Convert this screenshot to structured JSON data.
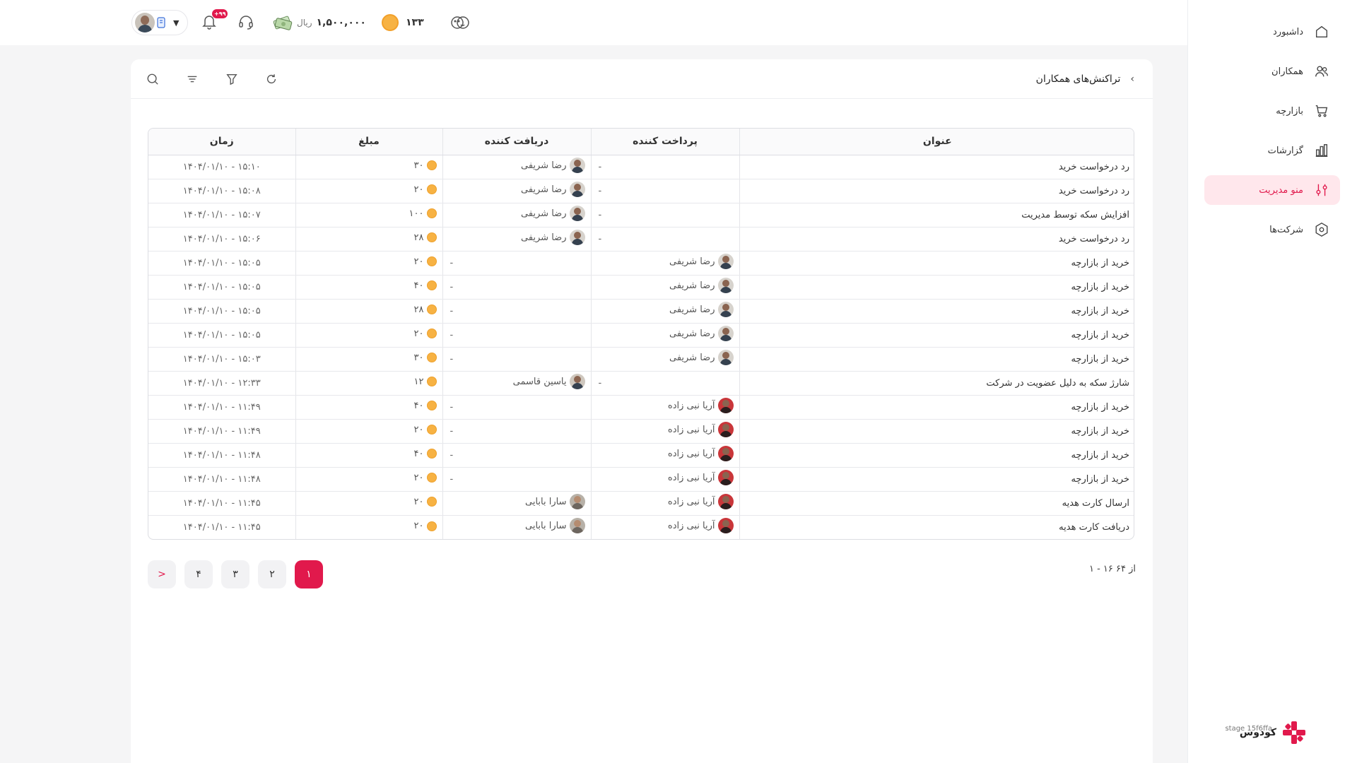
{
  "sidebar": {
    "items": [
      {
        "label": "داشبورد",
        "icon": "home-icon"
      },
      {
        "label": "همکاران",
        "icon": "users-icon"
      },
      {
        "label": "بازارچه",
        "icon": "cart-icon"
      },
      {
        "label": "گزارشات",
        "icon": "bar-chart-icon"
      },
      {
        "label": "منو مدیریت",
        "icon": "sliders-icon",
        "active": true
      },
      {
        "label": "شرکت‌ها",
        "icon": "hexagon-icon"
      }
    ],
    "brand": {
      "name": "کودوس",
      "sub": "stage 15f6ffa",
      "logo": "kudos-logo-icon"
    }
  },
  "header": {
    "notifications_badge": "+۹۹",
    "wallet_amount": "۱,۵۰۰,۰۰۰",
    "wallet_unit": "ریال",
    "coins": "۱۳۳",
    "accent_color": "#e1194c"
  },
  "page": {
    "title": "تراکنش‌های همکاران",
    "tools": [
      "search-icon",
      "sort-icon",
      "filter-icon",
      "refresh-icon"
    ]
  },
  "table": {
    "columns": [
      "عنوان",
      "پرداخت کننده",
      "دریافت کننده",
      "مبلغ",
      "زمان"
    ],
    "rows": [
      {
        "title": "رد درخواست خرید",
        "payer": "-",
        "payer_av": "",
        "receiver": "رضا شریفی",
        "receiver_av": "reza",
        "amount": "۳۰",
        "time": "۱۴۰۴/۰۱/۱۰ - ۱۵:۱۰"
      },
      {
        "title": "رد درخواست خرید",
        "payer": "-",
        "payer_av": "",
        "receiver": "رضا شریفی",
        "receiver_av": "reza",
        "amount": "۲۰",
        "time": "۱۴۰۴/۰۱/۱۰ - ۱۵:۰۸"
      },
      {
        "title": "افزایش سکه توسط مدیریت",
        "payer": "-",
        "payer_av": "",
        "receiver": "رضا شریفی",
        "receiver_av": "reza",
        "amount": "۱۰۰",
        "time": "۱۴۰۴/۰۱/۱۰ - ۱۵:۰۷"
      },
      {
        "title": "رد درخواست خرید",
        "payer": "-",
        "payer_av": "",
        "receiver": "رضا شریفی",
        "receiver_av": "reza",
        "amount": "۲۸",
        "time": "۱۴۰۴/۰۱/۱۰ - ۱۵:۰۶"
      },
      {
        "title": "خرید از بازارچه",
        "payer": "رضا شریفی",
        "payer_av": "reza",
        "receiver": "-",
        "receiver_av": "",
        "amount": "۲۰",
        "time": "۱۴۰۴/۰۱/۱۰ - ۱۵:۰۵"
      },
      {
        "title": "خرید از بازارچه",
        "payer": "رضا شریفی",
        "payer_av": "reza",
        "receiver": "-",
        "receiver_av": "",
        "amount": "۴۰",
        "time": "۱۴۰۴/۰۱/۱۰ - ۱۵:۰۵"
      },
      {
        "title": "خرید از بازارچه",
        "payer": "رضا شریفی",
        "payer_av": "reza",
        "receiver": "-",
        "receiver_av": "",
        "amount": "۲۸",
        "time": "۱۴۰۴/۰۱/۱۰ - ۱۵:۰۵"
      },
      {
        "title": "خرید از بازارچه",
        "payer": "رضا شریفی",
        "payer_av": "reza",
        "receiver": "-",
        "receiver_av": "",
        "amount": "۲۰",
        "time": "۱۴۰۴/۰۱/۱۰ - ۱۵:۰۵"
      },
      {
        "title": "خرید از بازارچه",
        "payer": "رضا شریفی",
        "payer_av": "reza",
        "receiver": "-",
        "receiver_av": "",
        "amount": "۳۰",
        "time": "۱۴۰۴/۰۱/۱۰ - ۱۵:۰۳"
      },
      {
        "title": "شارژ سکه به دلیل عضویت در شرکت",
        "payer": "-",
        "payer_av": "",
        "receiver": "یاسین قاسمی",
        "receiver_av": "yasin",
        "amount": "۱۲",
        "time": "۱۴۰۴/۰۱/۱۰ - ۱۲:۳۳"
      },
      {
        "title": "خرید از بازارچه",
        "payer": "آریا نبی زاده",
        "payer_av": "aria",
        "receiver": "-",
        "receiver_av": "",
        "amount": "۴۰",
        "time": "۱۴۰۴/۰۱/۱۰ - ۱۱:۴۹"
      },
      {
        "title": "خرید از بازارچه",
        "payer": "آریا نبی زاده",
        "payer_av": "aria",
        "receiver": "-",
        "receiver_av": "",
        "amount": "۲۰",
        "time": "۱۴۰۴/۰۱/۱۰ - ۱۱:۴۹"
      },
      {
        "title": "خرید از بازارچه",
        "payer": "آریا نبی زاده",
        "payer_av": "aria",
        "receiver": "-",
        "receiver_av": "",
        "amount": "۴۰",
        "time": "۱۴۰۴/۰۱/۱۰ - ۱۱:۴۸"
      },
      {
        "title": "خرید از بازارچه",
        "payer": "آریا نبی زاده",
        "payer_av": "aria",
        "receiver": "-",
        "receiver_av": "",
        "amount": "۲۰",
        "time": "۱۴۰۴/۰۱/۱۰ - ۱۱:۴۸"
      },
      {
        "title": "ارسال کارت هدیه",
        "payer": "آریا نبی زاده",
        "payer_av": "aria",
        "receiver": "سارا بابایی",
        "receiver_av": "sara",
        "amount": "۲۰",
        "time": "۱۴۰۴/۰۱/۱۰ - ۱۱:۴۵"
      },
      {
        "title": "دریافت کارت هدیه",
        "payer": "آریا نبی زاده",
        "payer_av": "aria",
        "receiver": "سارا بابایی",
        "receiver_av": "sara",
        "amount": "۲۰",
        "time": "۱۴۰۴/۰۱/۱۰ - ۱۱:۴۵"
      }
    ]
  },
  "pagination": {
    "range_text": "۱ - ۱۶ از ۶۴",
    "pages": [
      "۱",
      "۲",
      "۳",
      "۴"
    ],
    "current": "۱",
    "next_label": ">"
  }
}
